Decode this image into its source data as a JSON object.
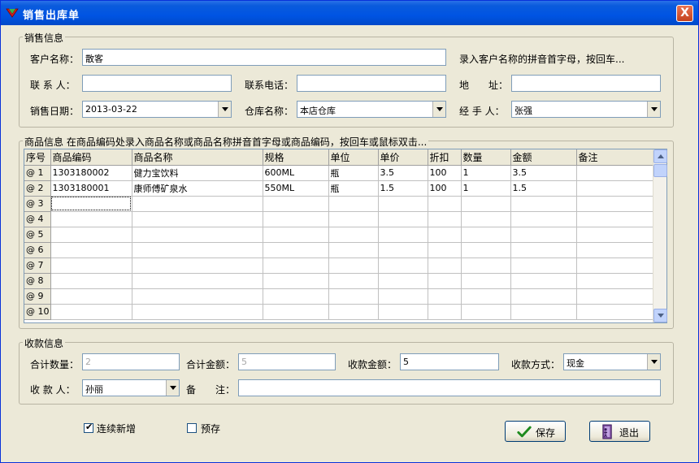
{
  "window": {
    "title": "销售出库单",
    "close_glyph": "X"
  },
  "sales_info": {
    "legend": "销售信息",
    "customer_label": "客户名称：",
    "customer_value": "散客",
    "customer_hint": "录入客户名称的拼音首字母，按回车...",
    "contact_label": "联 系 人：",
    "contact_value": "",
    "phone_label": "联系电话：",
    "phone_value": "",
    "address_label": "地　　址：",
    "address_value": "",
    "date_label": "销售日期：",
    "date_value": "2013-03-22",
    "warehouse_label": "仓库名称：",
    "warehouse_value": "本店仓库",
    "handler_label": "经 手 人：",
    "handler_value": "张强"
  },
  "goods_info": {
    "legend": "商品信息 在商品编码处录入商品名称或商品名称拼音首字母或商品编码，按回车或鼠标双击...",
    "columns": [
      "序号",
      "商品编码",
      "商品名称",
      "规格",
      "单位",
      "单价",
      "折扣",
      "数量",
      "金额",
      "备注"
    ],
    "rows": [
      {
        "no": "@ 1",
        "code": "1303180002",
        "name": "健力宝饮料",
        "spec": "600ML",
        "unit": "瓶",
        "price": "3.5",
        "discount": "100",
        "qty": "1",
        "amount": "3.5",
        "note": ""
      },
      {
        "no": "@ 2",
        "code": "1303180001",
        "name": "康师傅矿泉水",
        "spec": "550ML",
        "unit": "瓶",
        "price": "1.5",
        "discount": "100",
        "qty": "1",
        "amount": "1.5",
        "note": ""
      },
      {
        "no": "@ 3",
        "code": "",
        "name": "",
        "spec": "",
        "unit": "",
        "price": "",
        "discount": "",
        "qty": "",
        "amount": "",
        "note": ""
      },
      {
        "no": "@ 4",
        "code": "",
        "name": "",
        "spec": "",
        "unit": "",
        "price": "",
        "discount": "",
        "qty": "",
        "amount": "",
        "note": ""
      },
      {
        "no": "@ 5",
        "code": "",
        "name": "",
        "spec": "",
        "unit": "",
        "price": "",
        "discount": "",
        "qty": "",
        "amount": "",
        "note": ""
      },
      {
        "no": "@ 6",
        "code": "",
        "name": "",
        "spec": "",
        "unit": "",
        "price": "",
        "discount": "",
        "qty": "",
        "amount": "",
        "note": ""
      },
      {
        "no": "@ 7",
        "code": "",
        "name": "",
        "spec": "",
        "unit": "",
        "price": "",
        "discount": "",
        "qty": "",
        "amount": "",
        "note": ""
      },
      {
        "no": "@ 8",
        "code": "",
        "name": "",
        "spec": "",
        "unit": "",
        "price": "",
        "discount": "",
        "qty": "",
        "amount": "",
        "note": ""
      },
      {
        "no": "@ 9",
        "code": "",
        "name": "",
        "spec": "",
        "unit": "",
        "price": "",
        "discount": "",
        "qty": "",
        "amount": "",
        "note": ""
      },
      {
        "no": "@ 10",
        "code": "",
        "name": "",
        "spec": "",
        "unit": "",
        "price": "",
        "discount": "",
        "qty": "",
        "amount": "",
        "note": ""
      }
    ]
  },
  "payment_info": {
    "legend": "收款信息",
    "total_qty_label": "合计数量：",
    "total_qty_value": "2",
    "total_amount_label": "合计金额：",
    "total_amount_value": "5",
    "received_label": "收款金额：",
    "received_value": "5",
    "method_label": "收款方式：",
    "method_value": "现金",
    "payee_label": "收 款 人：",
    "payee_value": "孙丽",
    "remark_label": "备　　注：",
    "remark_value": ""
  },
  "footer": {
    "continuous_label": "连续新增",
    "continuous_checked": "✔",
    "reserve_label": "预存",
    "save_label": "保存",
    "exit_label": "退出"
  }
}
